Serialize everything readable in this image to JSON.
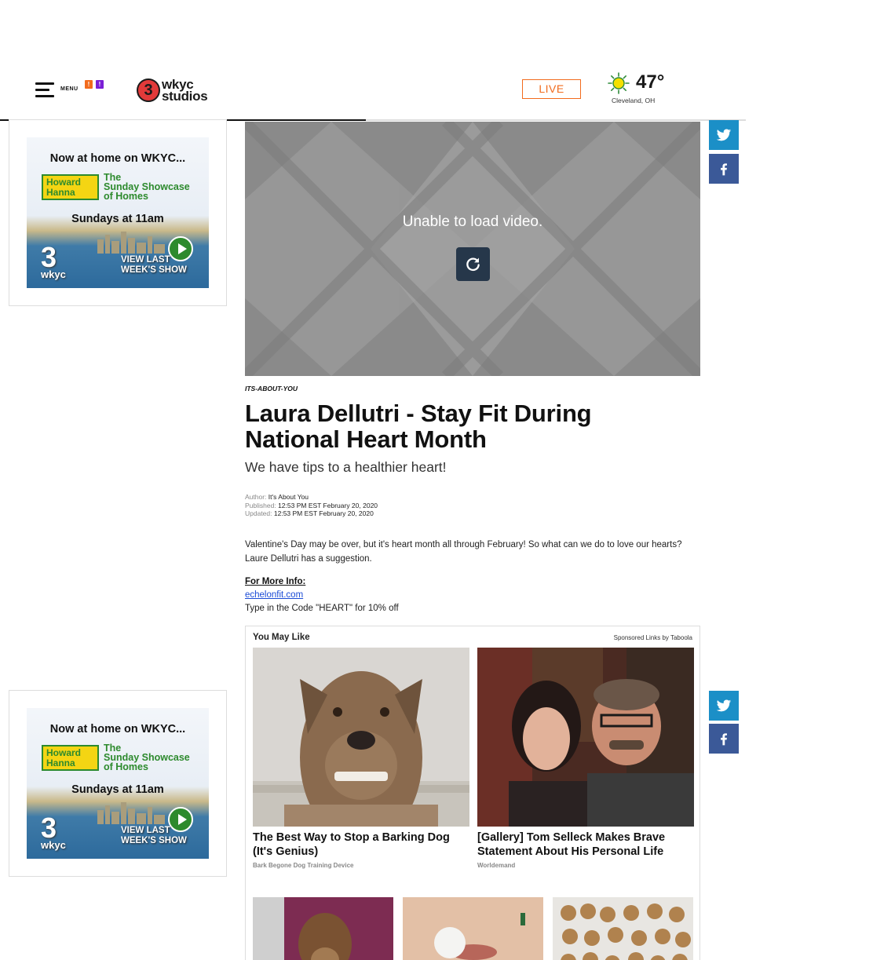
{
  "header": {
    "menu_label": "MENU",
    "badge_1": "!",
    "badge_2": "!",
    "logo_number": "3",
    "logo_line1": "wkyc",
    "logo_line2": "studios",
    "live_label": "LIVE",
    "weather": {
      "temp": "47°",
      "city": "Cleveland, OH",
      "icon": "sun-icon"
    },
    "reading_progress": 0.49
  },
  "ad": {
    "headline": "Now at home on WKYC...",
    "logo_line1": "Howard",
    "logo_line2": "Hanna",
    "show_line1": "The",
    "show_line2": "Sunday Showcase",
    "show_line3": "of Homes",
    "schedule": "Sundays at 11am",
    "station_number": "3",
    "station": "wkyc",
    "cta_line1": "VIEW LAST",
    "cta_line2": "WEEK'S SHOW"
  },
  "social": {
    "twitter_icon": "twitter-icon",
    "facebook_icon": "facebook-icon"
  },
  "video": {
    "message": "Unable to load video.",
    "reload_icon": "reload-icon"
  },
  "article": {
    "kicker": "ITS-ABOUT-YOU",
    "headline": "Laura Dellutri - Stay Fit During National Heart Month",
    "dek": "We have tips to a healthier heart!",
    "author_label": "Author:",
    "author": "It's About You",
    "published_label": "Published:",
    "published": "12:53 PM EST February 20, 2020",
    "updated_label": "Updated:",
    "updated": "12:53 PM EST February 20, 2020",
    "body": "Valentine's Day may be over, but it's heart month all through February! So what can we do to love our hearts? Laure Dellutri has a suggestion.",
    "info_heading": "For More Info:",
    "info_link": "echelonfit.com",
    "info_code": "Type in the Code \"HEART\" for 10% off"
  },
  "recommendations": {
    "title": "You May Like",
    "sponsor": "Sponsored Links by Taboola",
    "cards": [
      {
        "title": "The Best Way to Stop a Barking Dog (It's Genius)",
        "source": "Bark Begone Dog Training Device"
      },
      {
        "title": "[Gallery] Tom Selleck Makes Brave Statement About His Personal Life",
        "source": "Worldemand"
      }
    ]
  }
}
